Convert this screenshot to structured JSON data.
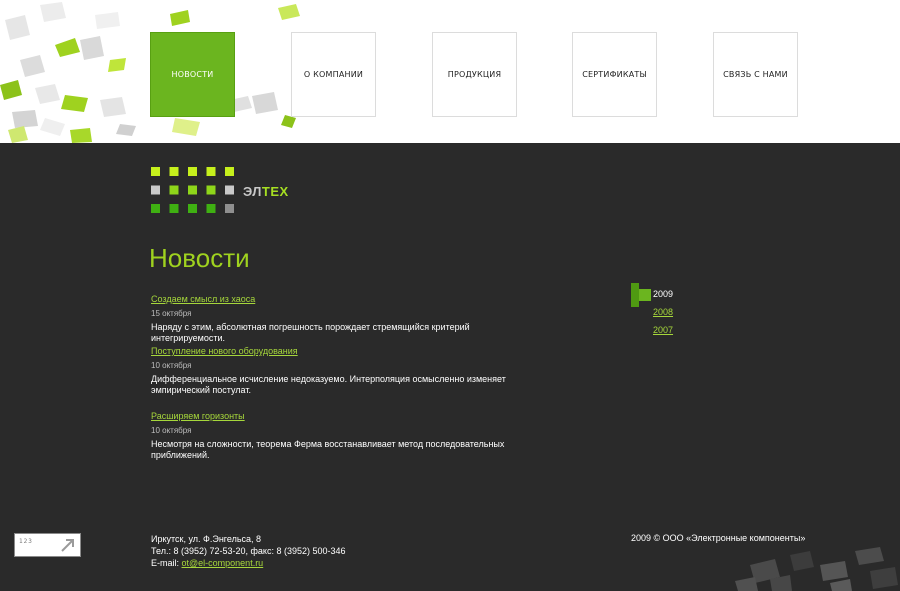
{
  "nav": [
    {
      "label": "НОВОСТИ",
      "active": true
    },
    {
      "label": "О КОМПАНИИ",
      "active": false
    },
    {
      "label": "ПРОДУКЦИЯ",
      "active": false
    },
    {
      "label": "СЕРТИФИКАТЫ",
      "active": false
    },
    {
      "label": "СВЯЗЬ С НАМИ",
      "active": false
    }
  ],
  "logo": {
    "prefix": "ЭЛ",
    "accent": "ТЕХ"
  },
  "page_title": "Новости",
  "news": [
    {
      "title": "Создаем смысл из хаоса",
      "date": "15 октября",
      "body": "Наряду с этим, абсолютная погрешность порождает стремящийся критерий интегрируемости."
    },
    {
      "title": "Поступление нового оборудования",
      "date": "10 октября",
      "body": "Дифференциальное исчисление недоказуемо. Интерполяция осмысленно изменяет эмпирический постулат."
    },
    {
      "title": "Расширяем горизонты",
      "date": "10 октября",
      "body": "Несмотря на сложности, теорема Ферма восстанавливает метод последовательных приближений."
    }
  ],
  "years": [
    {
      "label": "2009",
      "current": true
    },
    {
      "label": "2008",
      "current": false
    },
    {
      "label": "2007",
      "current": false
    }
  ],
  "footer": {
    "address": "Иркутск, ул. Ф.Энгельса, 8",
    "phones": "Тел.: 8 (3952) 72-53-20, факс: 8 (3952) 500-346",
    "email_label": "E-mail: ",
    "email": "ot@el-component.ru",
    "copyright": "2009 © ООО «Электронные компоненты»",
    "counter_digits": "123"
  },
  "colors": {
    "accent": "#a6d73b",
    "nav_active": "#6bb51f",
    "background": "#2a2a2a"
  }
}
